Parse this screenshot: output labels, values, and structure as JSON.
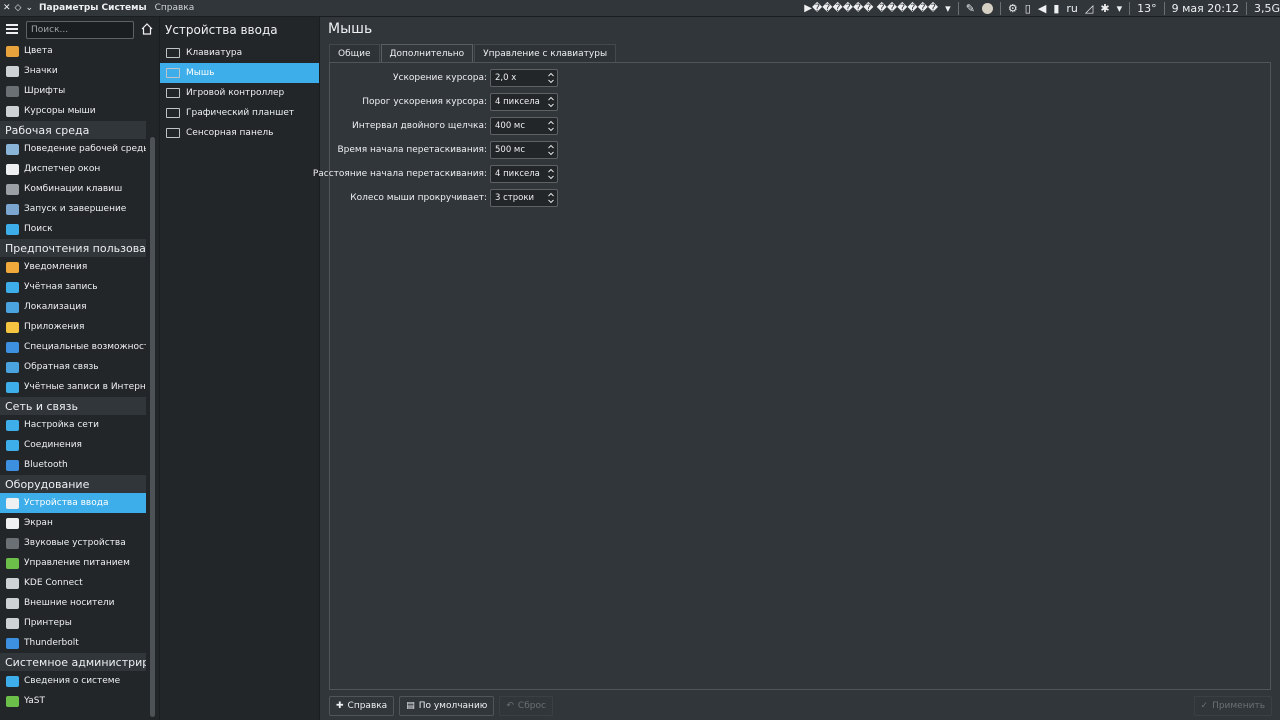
{
  "topbar": {
    "app_title": "Параметры Системы",
    "menu_help": "Справка",
    "tray": {
      "media": "▶������ ������",
      "lang": "ru",
      "temp": "13°",
      "datetime": "9 мая 20:12",
      "mem": "3,5G"
    }
  },
  "sidebar": {
    "search_placeholder": "Поиск...",
    "items": [
      {
        "label": "Цвета",
        "type": "item",
        "color": "#e8a33d"
      },
      {
        "label": "Значки",
        "type": "item",
        "color": "#cfd2d5"
      },
      {
        "label": "Шрифты",
        "type": "item",
        "color": "#6b7075"
      },
      {
        "label": "Курсоры мыши",
        "type": "item",
        "color": "#cfd2d5"
      },
      {
        "label": "Рабочая среда",
        "type": "category"
      },
      {
        "label": "Поведение рабочей среды",
        "type": "item",
        "color": "#8ab4d8"
      },
      {
        "label": "Диспетчер окон",
        "type": "item",
        "color": "#eff0f1"
      },
      {
        "label": "Комбинации клавиш",
        "type": "item",
        "color": "#9aa0a6"
      },
      {
        "label": "Запуск и завершение",
        "type": "item",
        "color": "#7aa6d0"
      },
      {
        "label": "Поиск",
        "type": "item",
        "color": "#3daee9"
      },
      {
        "label": "Предпочтения пользовател",
        "type": "category"
      },
      {
        "label": "Уведомления",
        "type": "item",
        "color": "#f2a93b"
      },
      {
        "label": "Учётная запись",
        "type": "item",
        "color": "#3daee9"
      },
      {
        "label": "Локализация",
        "type": "item",
        "color": "#4aa3df"
      },
      {
        "label": "Приложения",
        "type": "item",
        "color": "#f5c542"
      },
      {
        "label": "Специальные возможности",
        "type": "item",
        "color": "#3d8fe0"
      },
      {
        "label": "Обратная связь",
        "type": "item",
        "color": "#4aa3df"
      },
      {
        "label": "Учётные записи в Интерн…",
        "type": "item",
        "color": "#3daee9"
      },
      {
        "label": "Сеть и связь",
        "type": "category"
      },
      {
        "label": "Настройка сети",
        "type": "item",
        "color": "#3daee9"
      },
      {
        "label": "Соединения",
        "type": "item",
        "color": "#3daee9"
      },
      {
        "label": "Bluetooth",
        "type": "item",
        "color": "#3d8fe0"
      },
      {
        "label": "Оборудование",
        "type": "category"
      },
      {
        "label": "Устройства ввода",
        "type": "item",
        "color": "#eff0f1",
        "active": true
      },
      {
        "label": "Экран",
        "type": "item",
        "color": "#eff0f1"
      },
      {
        "label": "Звуковые устройства",
        "type": "item",
        "color": "#6b7075"
      },
      {
        "label": "Управление питанием",
        "type": "item",
        "color": "#6cc04a"
      },
      {
        "label": "KDE Connect",
        "type": "item",
        "color": "#cfd2d5"
      },
      {
        "label": "Внешние носители",
        "type": "item",
        "color": "#cfd2d5"
      },
      {
        "label": "Принтеры",
        "type": "item",
        "color": "#cfd2d5"
      },
      {
        "label": "Thunderbolt",
        "type": "item",
        "color": "#3d8fe0"
      },
      {
        "label": "Системное администрирова",
        "type": "category"
      },
      {
        "label": "Сведения о системе",
        "type": "item",
        "color": "#3daee9"
      },
      {
        "label": "YaST",
        "type": "item",
        "color": "#6cc04a"
      }
    ]
  },
  "midpanel": {
    "title": "Устройства ввода",
    "items": [
      {
        "label": "Клавиатура"
      },
      {
        "label": "Мышь",
        "active": true
      },
      {
        "label": "Игровой контроллер"
      },
      {
        "label": "Графический планшет"
      },
      {
        "label": "Сенсорная панель"
      }
    ]
  },
  "content": {
    "title": "Мышь",
    "tabs": [
      {
        "label": "Общие"
      },
      {
        "label": "Дополнительно",
        "active": true
      },
      {
        "label": "Управление с клавиатуры"
      }
    ],
    "fields": [
      {
        "label": "Ускорение курсора:",
        "value": "2,0 x"
      },
      {
        "label": "Порог ускорения курсора:",
        "value": "4 пиксела"
      },
      {
        "label": "Интервал двойного щелчка:",
        "value": "400 мс"
      },
      {
        "label": "Время начала перетаскивания:",
        "value": "500 мс"
      },
      {
        "label": "Расстояние начала перетаскивания:",
        "value": "4 пиксела"
      },
      {
        "label": "Колесо мыши прокручивает:",
        "value": "3 строки"
      }
    ],
    "buttons": {
      "help": "Справка",
      "defaults": "По умолчанию",
      "reset": "Сброс",
      "apply": "Применить"
    }
  }
}
